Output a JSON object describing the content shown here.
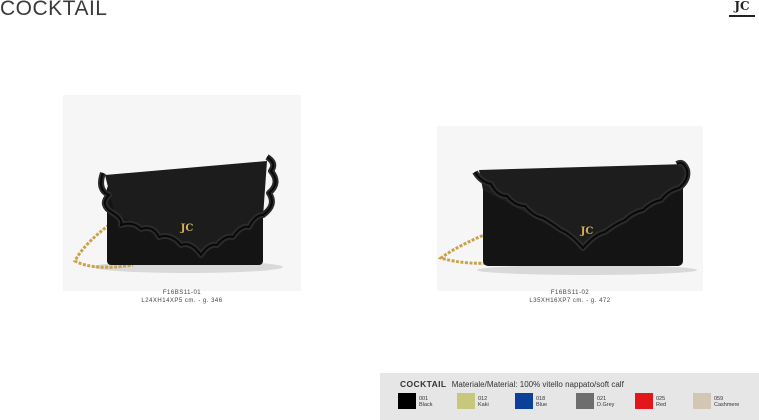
{
  "header": {
    "title": "COCKTAIL",
    "logo_text": "JC"
  },
  "products": [
    {
      "code": "F16BS11-01",
      "dims": "L24XH14XP5 cm. - g. 346",
      "logo_text": "JC"
    },
    {
      "code": "F16BS11-02",
      "dims": "L35XH16XP7 cm. - g. 472",
      "logo_text": "JC"
    }
  ],
  "swatch_panel": {
    "collection": "COCKTAIL",
    "material": "Materiale/Material: 100% vitello nappato/soft calf",
    "colors": [
      {
        "code": "001",
        "name": "Black",
        "hex": "#000000"
      },
      {
        "code": "012",
        "name": "Kaki",
        "hex": "#c8c77e"
      },
      {
        "code": "018",
        "name": "Blue",
        "hex": "#0b3f9a"
      },
      {
        "code": "021",
        "name": "D.Grey",
        "hex": "#6e6e6e"
      },
      {
        "code": "025",
        "name": "Red",
        "hex": "#e3161b"
      },
      {
        "code": "059",
        "name": "Cashmere",
        "hex": "#d4c6b4"
      }
    ]
  }
}
